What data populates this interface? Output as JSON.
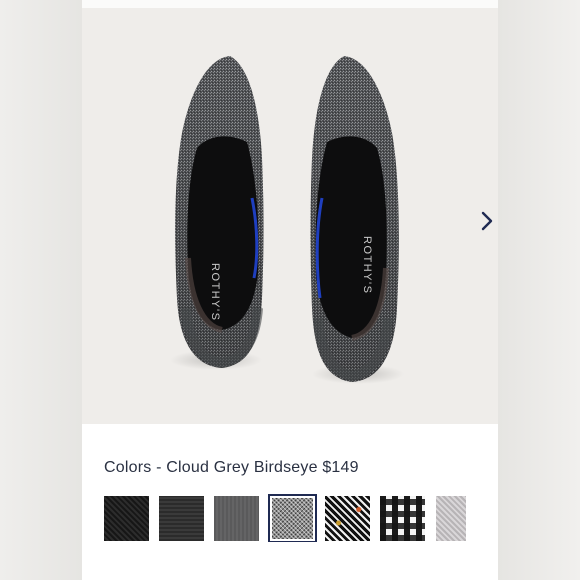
{
  "product": {
    "image_alt": "Rothy's pointed flats pair",
    "insole_brand": "ROTHY'S"
  },
  "colors": {
    "prefix": "Colors",
    "separator": "-",
    "selected_name": "Cloud Grey Birdseye",
    "price": "$149",
    "full_label": "Colors - Cloud Grey Birdseye $149"
  },
  "swatches": [
    {
      "name": "Black",
      "color": "#1f1f1f"
    },
    {
      "name": "Black Stripe",
      "color": "#333333"
    },
    {
      "name": "Grey",
      "color": "#5f5f60"
    },
    {
      "name": "Cloud Grey Birdseye",
      "color": "#7a7a7a",
      "selected": true
    },
    {
      "name": "Black Pattern",
      "color": "#222222"
    },
    {
      "name": "Black White Gingham",
      "color": "#888888"
    },
    {
      "name": "Light Grey",
      "color": "#c6c3c5"
    }
  ],
  "icons": {
    "next": "chevron-right-icon"
  },
  "accent_color": "#1f2a52"
}
